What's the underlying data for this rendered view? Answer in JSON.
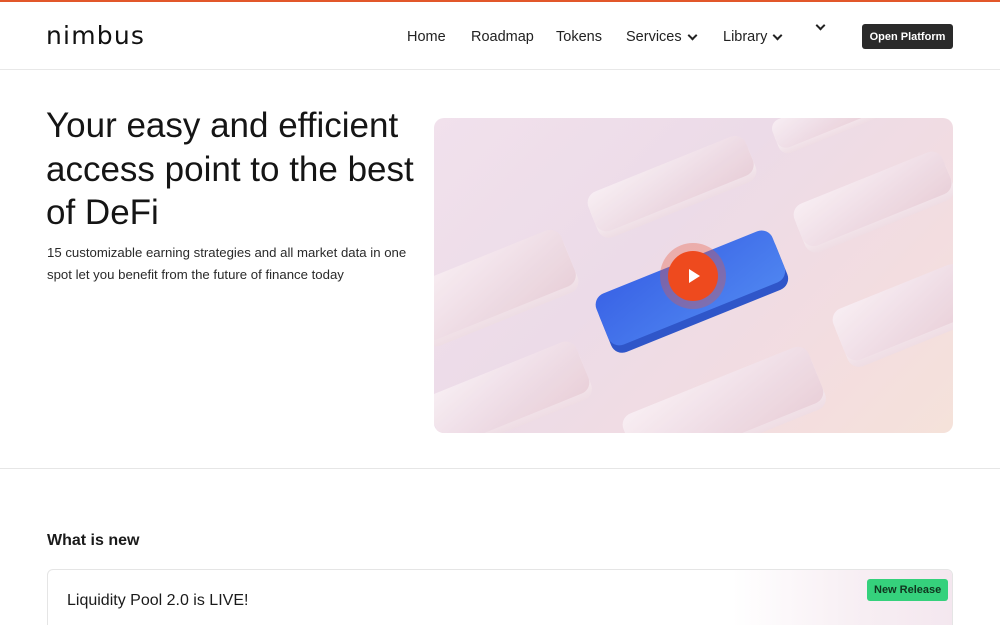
{
  "header": {
    "logo": "nimbus",
    "nav": [
      {
        "label": "Home",
        "has_dropdown": false
      },
      {
        "label": "Roadmap",
        "has_dropdown": false
      },
      {
        "label": "Tokens",
        "has_dropdown": false
      },
      {
        "label": "Services",
        "has_dropdown": true
      },
      {
        "label": "Library",
        "has_dropdown": true
      },
      {
        "label": "",
        "has_dropdown": true
      }
    ],
    "cta_label": "Open Platform"
  },
  "hero": {
    "title": "Your easy and efficient access point to the best of DeFi",
    "subtitle": "15 customizable earning strategies and all market data in one spot let you benefit from the future of finance today",
    "video": {
      "play_icon": "play-icon",
      "accent": "#ee4a1e",
      "featured_tile": "#3f6fe8"
    }
  },
  "whats_new": {
    "heading": "What is new",
    "items": [
      {
        "title": "Liquidity Pool 2.0 is LIVE!",
        "badge": "New Release",
        "badge_color": "#35d17c"
      }
    ]
  },
  "colors": {
    "top_accent": "#e2572a",
    "cta_bg": "#2a2a2a"
  }
}
